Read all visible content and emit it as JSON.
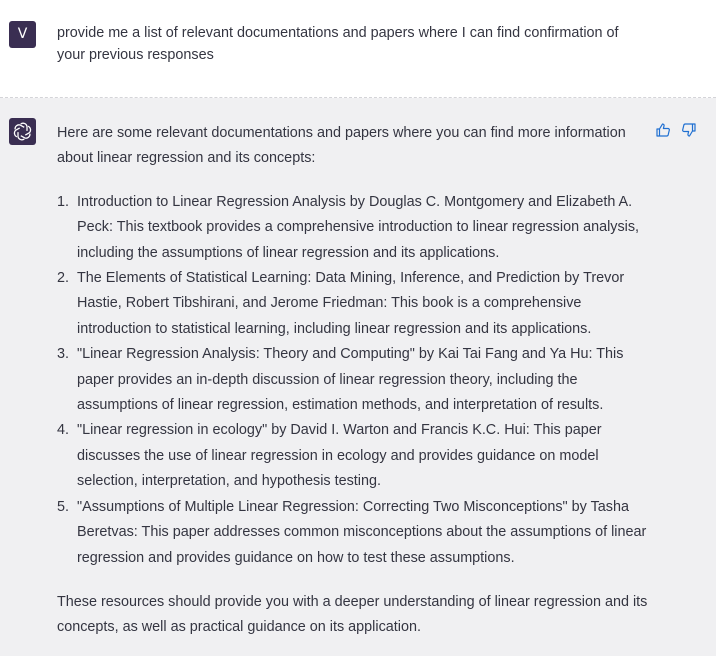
{
  "user_message": {
    "avatar_letter": "V",
    "text": "provide me a list of relevant documentations and papers where I can find confirmation of your previous responses"
  },
  "assistant_message": {
    "intro": "Here are some relevant documentations and papers where you can find more information about linear regression and its concepts:",
    "references": [
      {
        "number": "1.",
        "text": "Introduction to Linear Regression Analysis by Douglas C. Montgomery and Elizabeth A. Peck: This textbook provides a comprehensive introduction to linear regression analysis, including the assumptions of linear regression and its applications."
      },
      {
        "number": "2.",
        "text": "The Elements of Statistical Learning: Data Mining, Inference, and Prediction by Trevor Hastie, Robert Tibshirani, and Jerome Friedman: This book is a comprehensive introduction to statistical learning, including linear regression and its applications."
      },
      {
        "number": "3.",
        "text": "\"Linear Regression Analysis: Theory and Computing\" by Kai Tai Fang and Ya Hu: This paper provides an in-depth discussion of linear regression theory, including the assumptions of linear regression, estimation methods, and interpretation of results."
      },
      {
        "number": "4.",
        "text": "\"Linear regression in ecology\" by David I. Warton and Francis K.C. Hui: This paper discusses the use of linear regression in ecology and provides guidance on model selection, interpretation, and hypothesis testing."
      },
      {
        "number": "5.",
        "text": "\"Assumptions of Multiple Linear Regression: Correcting Two Misconceptions\" by Tasha Beretvas: This paper addresses common misconceptions about the assumptions of linear regression and provides guidance on how to test these assumptions."
      }
    ],
    "outro": "These resources should provide you with a deeper understanding of linear regression and its concepts, as well as practical guidance on its application."
  },
  "icons": {
    "bot_avatar": "openai-logo-icon",
    "thumbs_up": "thumbs-up-icon",
    "thumbs_down": "thumbs-down-icon"
  },
  "colors": {
    "avatar_bg": "#3a2e52",
    "assistant_bg": "#f0f0f2",
    "text": "#343541",
    "icon": "#1f6fd1"
  }
}
